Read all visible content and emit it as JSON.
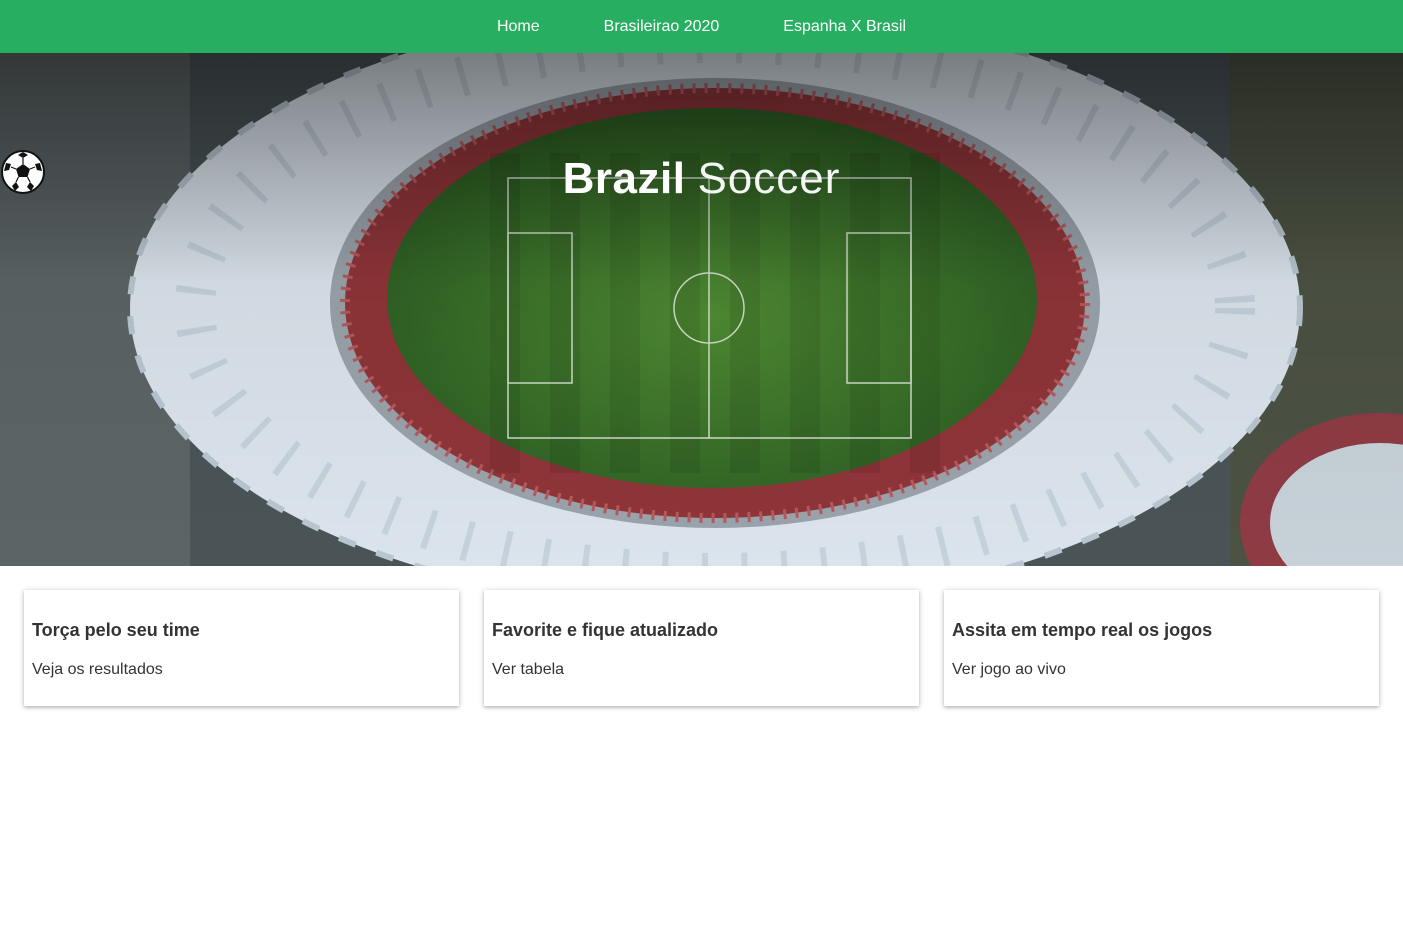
{
  "nav": {
    "items": [
      {
        "label": "Home"
      },
      {
        "label": "Brasileirao 2020"
      },
      {
        "label": "Espanha X Brasil"
      }
    ]
  },
  "hero": {
    "brand_bold": "Brazil",
    "brand_light": "Soccer",
    "brand_icon": "soccer-ball-icon",
    "background": "stadium-aerial-photo"
  },
  "cards": [
    {
      "title": "Torça pelo seu time",
      "link": "Veja os resultados"
    },
    {
      "title": "Favorite e fique atualizado",
      "link": "Ver tabela"
    },
    {
      "title": "Assita em tempo real os jogos",
      "link": "Ver jogo ao vivo"
    }
  ],
  "colors": {
    "navbar": "#27ae60",
    "text": "#333333",
    "pitch": "#3f7a2f",
    "stands": "#9b3a3f",
    "roof": "#dfe7ee"
  }
}
